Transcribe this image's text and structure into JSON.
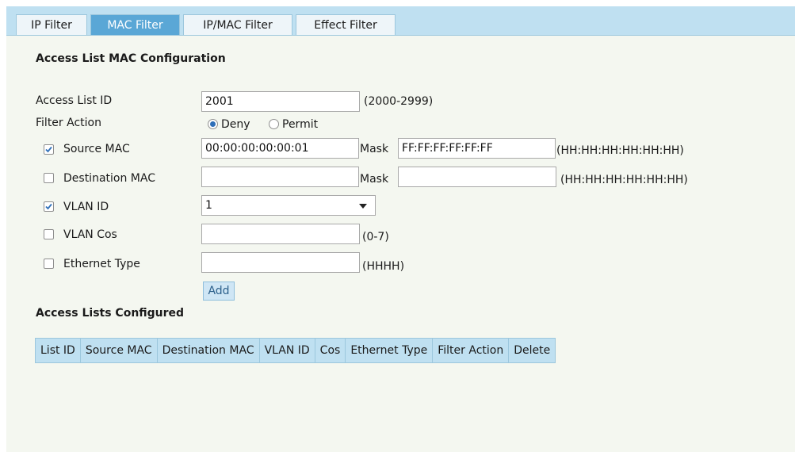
{
  "tabs": [
    {
      "label": "IP Filter",
      "active": false
    },
    {
      "label": "MAC Filter",
      "active": true
    },
    {
      "label": "IP/MAC Filter",
      "active": false
    },
    {
      "label": "Effect Filter",
      "active": false
    }
  ],
  "config": {
    "title": "Access List MAC Configuration",
    "access_list_id": {
      "label": "Access List ID",
      "value": "2001",
      "hint": "(2000-2999)"
    },
    "filter_action": {
      "label": "Filter Action",
      "options": [
        "Deny",
        "Permit"
      ],
      "selected": "Deny"
    },
    "source_mac": {
      "label": "Source MAC",
      "checked": true,
      "value": "00:00:00:00:00:01",
      "mask_label": "Mask",
      "mask_value": "FF:FF:FF:FF:FF:FF",
      "hint": "(HH:HH:HH:HH:HH:HH)"
    },
    "destination_mac": {
      "label": "Destination MAC",
      "checked": false,
      "value": "",
      "mask_label": "Mask",
      "mask_value": "",
      "hint": "(HH:HH:HH:HH:HH:HH)"
    },
    "vlan_id": {
      "label": "VLAN ID",
      "checked": true,
      "selected": "1"
    },
    "vlan_cos": {
      "label": "VLAN Cos",
      "checked": false,
      "value": "",
      "hint": "(0-7)"
    },
    "ethernet_type": {
      "label": "Ethernet Type",
      "checked": false,
      "value": "",
      "hint": "(HHHH)"
    },
    "add_label": "Add"
  },
  "lists": {
    "title": "Access Lists Configured",
    "columns": [
      "List ID",
      "Source MAC",
      "Destination MAC",
      "VLAN ID",
      "Cos",
      "Ethernet Type",
      "Filter Action",
      "Delete"
    ]
  },
  "colors": {
    "tab_bar": "#bfe0f1",
    "active_tab": "#5aa7d6",
    "panel": "#f4f7f0",
    "table_header": "#bfe0f1",
    "button": "#cfe6f5"
  }
}
